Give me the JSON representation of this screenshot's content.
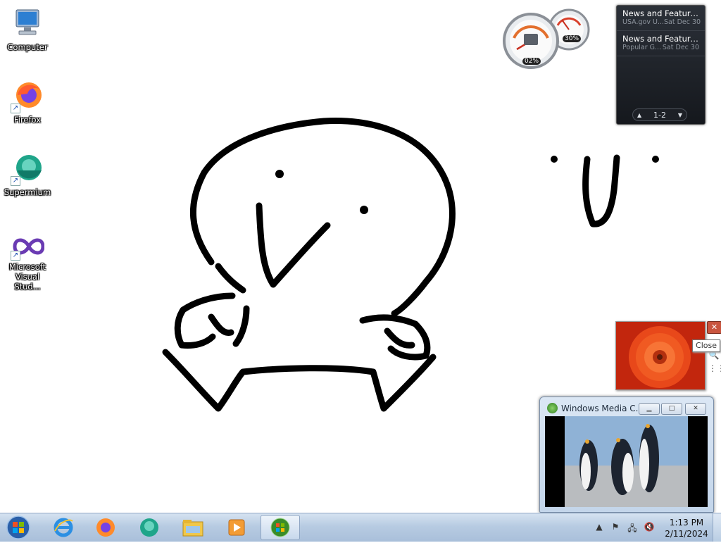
{
  "desktop": {
    "icons": [
      {
        "label": "Computer",
        "icon": "computer-icon"
      },
      {
        "label": "Firefox",
        "icon": "firefox-icon"
      },
      {
        "label": "Supermium",
        "icon": "supermium-icon"
      },
      {
        "label": "Microsoft Visual Stud...",
        "icon": "visual-studio-icon"
      }
    ]
  },
  "gadgets": {
    "cpu_meter": {
      "cpu_percent": "02%",
      "memory_percent": "30%"
    },
    "news": {
      "items": [
        {
          "title": "News and Feature...",
          "source": "USA.gov U...",
          "date": "Sat Dec 30"
        },
        {
          "title": "News and Feature...",
          "source": "Popular G...",
          "date": "Sat Dec 30"
        }
      ],
      "pager": "1-2"
    },
    "slideshow": {
      "close_tooltip": "Close"
    }
  },
  "media_center": {
    "title": "Windows Media C..."
  },
  "taskbar": {
    "pinned": [
      "ie-icon",
      "firefox-icon",
      "supermium-icon",
      "explorer-icon",
      "media-player-icon",
      "media-center-icon"
    ],
    "clock": {
      "time": "1:13 PM",
      "date": "2/11/2024"
    }
  },
  "colors": {
    "taskbar": "#b7cbe2",
    "news_bg": "#1f2329",
    "slideshow_flower": "#e8481a"
  }
}
